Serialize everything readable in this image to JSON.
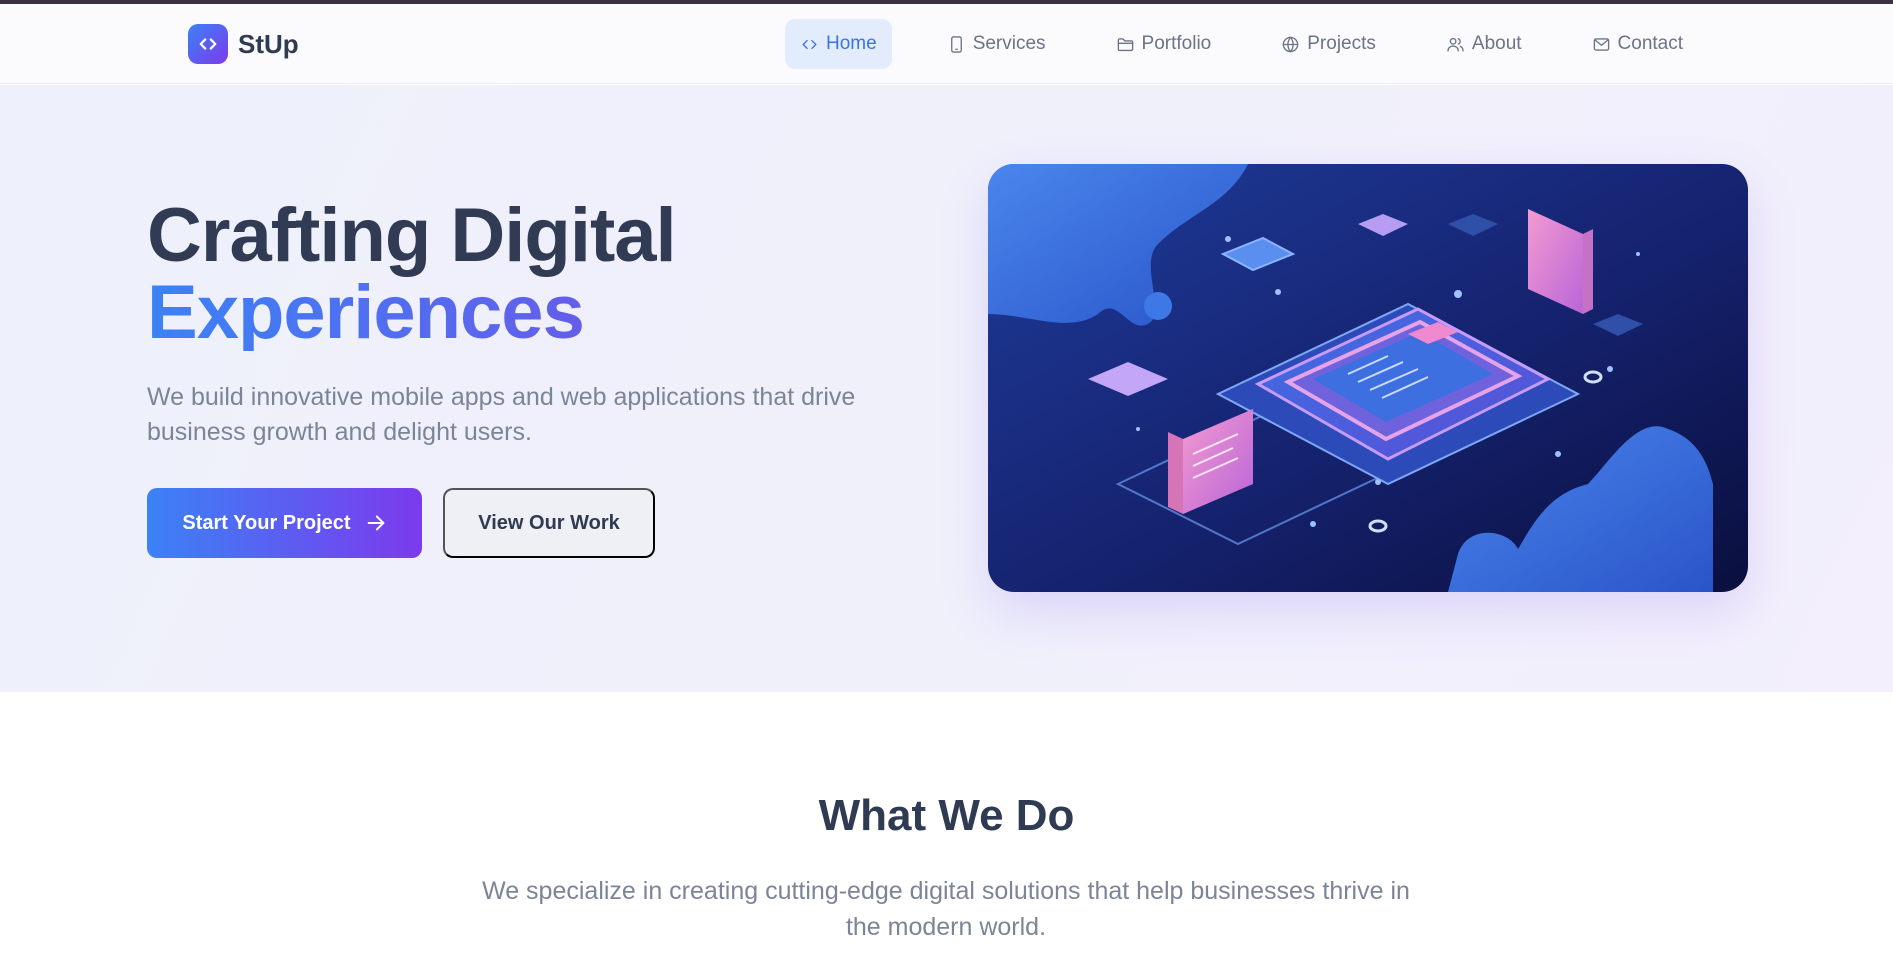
{
  "brand": {
    "name": "StUp"
  },
  "nav": {
    "items": [
      {
        "label": "Home",
        "icon": "code-icon",
        "active": true
      },
      {
        "label": "Services",
        "icon": "smartphone-icon"
      },
      {
        "label": "Portfolio",
        "icon": "folder-icon"
      },
      {
        "label": "Projects",
        "icon": "globe-icon"
      },
      {
        "label": "About",
        "icon": "users-icon"
      },
      {
        "label": "Contact",
        "icon": "mail-icon"
      }
    ]
  },
  "hero": {
    "title_line1": "Crafting Digital",
    "title_line2": "Experiences",
    "subtitle": "We build innovative mobile apps and web applications that drive business growth and delight users.",
    "primary_button": "Start Your Project",
    "secondary_button": "View Our Work",
    "image_icon": "isometric-tech-illustration"
  },
  "section": {
    "title": "What We Do",
    "subtitle": "We specialize in creating cutting-edge digital solutions that help businesses thrive in the modern world."
  },
  "colors": {
    "accent_blue": "#3b82f6",
    "accent_purple": "#7c3aed",
    "heading": "#2f3b52",
    "muted": "#7c8597"
  }
}
